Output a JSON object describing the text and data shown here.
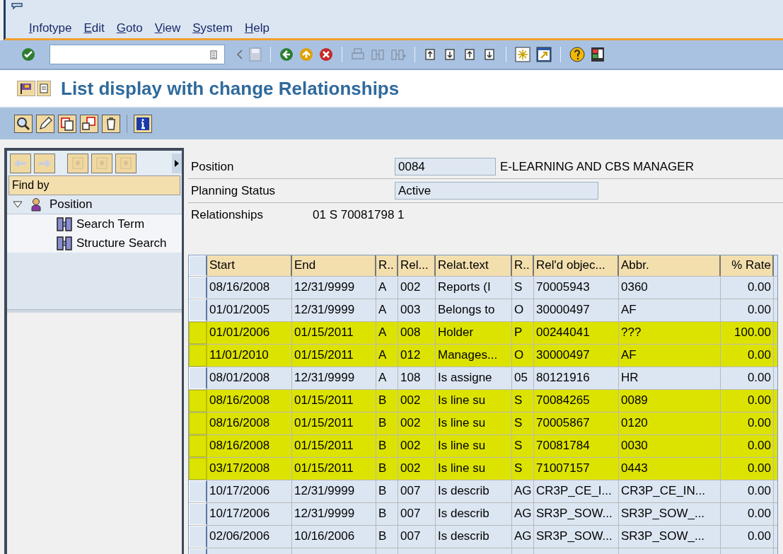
{
  "menu": [
    "Infotype",
    "Edit",
    "Goto",
    "View",
    "System",
    "Help"
  ],
  "title": "List display with change Relationships",
  "nav": {
    "find_by": "Find by",
    "tree": [
      {
        "label": "Position",
        "expanded": true,
        "children": [
          {
            "label": "Search Term"
          },
          {
            "label": "Structure Search"
          }
        ]
      }
    ]
  },
  "header": {
    "position": {
      "label": "Position",
      "value": "0084",
      "text": "E-LEARNING AND CBS MANAGER"
    },
    "planning_status": {
      "label": "Planning Status",
      "value": "Active"
    },
    "relationships": {
      "label": "Relationships",
      "text": "01 S  70081798 1"
    }
  },
  "table": {
    "columns": [
      "Start",
      "End",
      "R..",
      "Rel...",
      "Relat.text",
      "R..",
      "Rel'd objec...",
      "Abbr.",
      "% Rate"
    ],
    "rows": [
      {
        "cells": [
          "08/16/2008",
          "12/31/9999",
          "A",
          "002",
          "Reports (I",
          "S",
          "70005943",
          "0360",
          "0.00"
        ],
        "highlighted": false
      },
      {
        "cells": [
          "01/01/2005",
          "12/31/9999",
          "A",
          "003",
          "Belongs to",
          "O",
          "30000497",
          "AF",
          "0.00"
        ],
        "highlighted": false
      },
      {
        "cells": [
          "01/01/2006",
          "01/15/2011",
          "A",
          "008",
          "Holder",
          "P",
          "00244041",
          "???",
          "100.00"
        ],
        "highlighted": true
      },
      {
        "cells": [
          "11/01/2010",
          "01/15/2011",
          "A",
          "012",
          "Manages...",
          "O",
          "30000497",
          "AF",
          "0.00"
        ],
        "highlighted": true
      },
      {
        "cells": [
          "08/01/2008",
          "12/31/9999",
          "A",
          "108",
          "Is assigne",
          "05",
          "80121916",
          "HR",
          "0.00"
        ],
        "highlighted": false
      },
      {
        "cells": [
          "08/16/2008",
          "01/15/2011",
          "B",
          "002",
          "Is line su",
          "S",
          "70084265",
          "0089",
          "0.00"
        ],
        "highlighted": true
      },
      {
        "cells": [
          "08/16/2008",
          "01/15/2011",
          "B",
          "002",
          "Is line su",
          "S",
          "70005867",
          "0120",
          "0.00"
        ],
        "highlighted": true
      },
      {
        "cells": [
          "08/16/2008",
          "01/15/2011",
          "B",
          "002",
          "Is line su",
          "S",
          "70081784",
          "0030",
          "0.00"
        ],
        "highlighted": true
      },
      {
        "cells": [
          "03/17/2008",
          "01/15/2011",
          "B",
          "002",
          "Is line su",
          "S",
          "71007157",
          "0443",
          "0.00"
        ],
        "highlighted": true
      },
      {
        "cells": [
          "10/17/2006",
          "12/31/9999",
          "B",
          "007",
          "Is describ",
          "AG",
          "CR3P_CE_I...",
          "CR3P_CE_IN...",
          "0.00"
        ],
        "highlighted": false
      },
      {
        "cells": [
          "10/17/2006",
          "12/31/9999",
          "B",
          "007",
          "Is describ",
          "AG",
          "SR3P_SOW...",
          "SR3P_SOW_...",
          "0.00"
        ],
        "highlighted": false
      },
      {
        "cells": [
          "02/06/2006",
          "10/16/2006",
          "B",
          "007",
          "Is describ",
          "AG",
          "SR3P_SOW...",
          "SR3P_SOW_...",
          "0.00"
        ],
        "highlighted": false
      }
    ]
  }
}
